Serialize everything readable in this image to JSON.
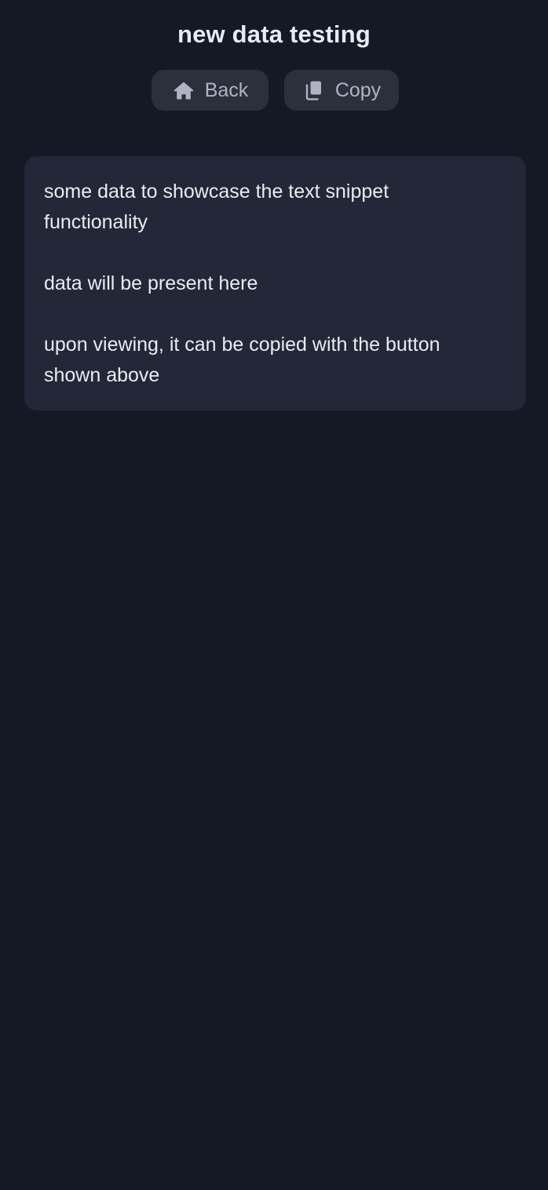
{
  "page": {
    "title": "new data testing"
  },
  "toolbar": {
    "back": {
      "label": "Back",
      "icon": "home-icon"
    },
    "copy": {
      "label": "Copy",
      "icon": "copy-icon"
    }
  },
  "snippet": {
    "text": "some data to showcase the text snippet\nfunctionality\n\ndata will be present here\n\nupon viewing, it can be copied with the button\nshown above"
  },
  "colors": {
    "background": "#141926",
    "card": "#222837",
    "button": "#2b303d",
    "text": "#e9ecf2",
    "button_text": "#aeb4c2"
  }
}
